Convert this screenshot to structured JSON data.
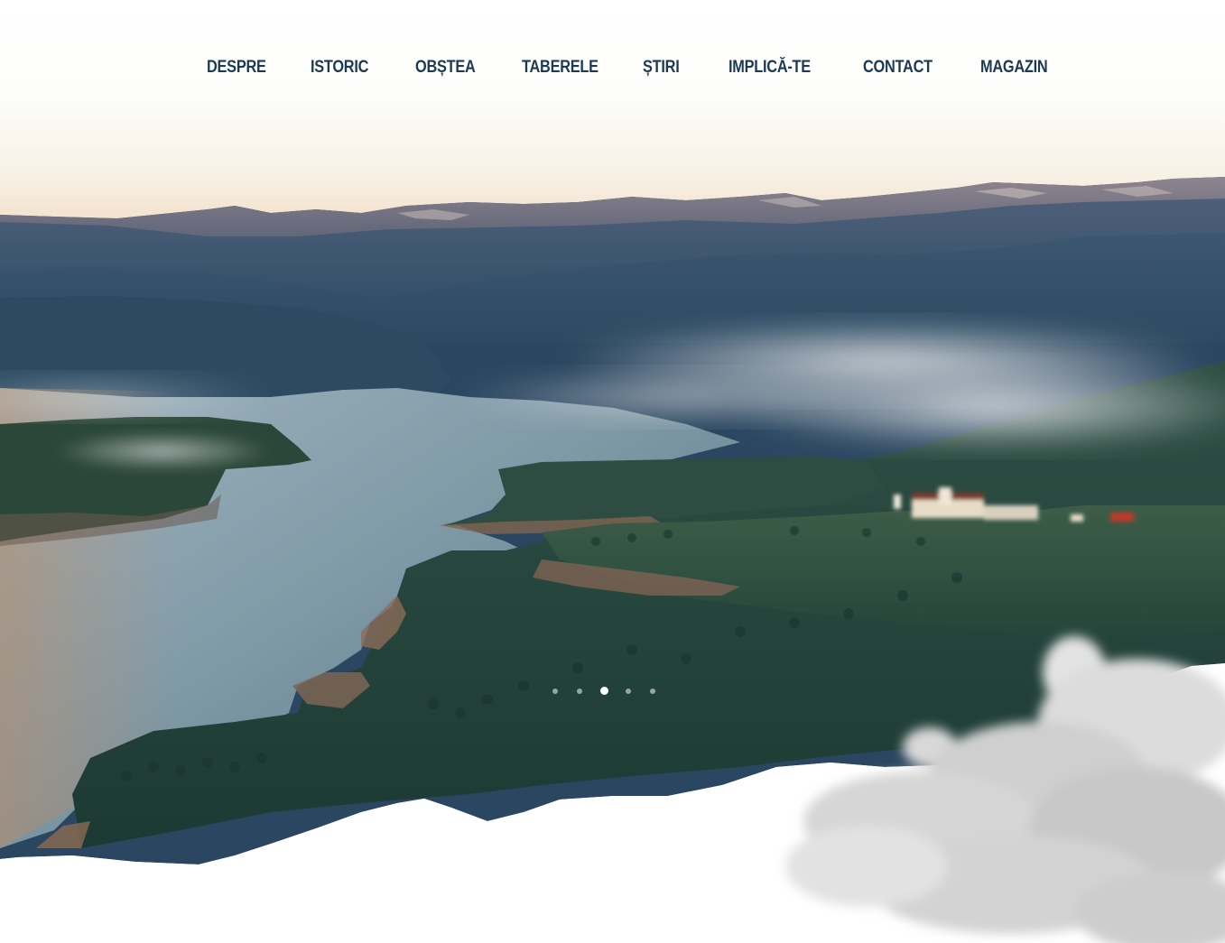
{
  "nav": {
    "items": [
      {
        "label": "DESPRE"
      },
      {
        "label": "ISTORIC"
      },
      {
        "label": "OBȘTEA"
      },
      {
        "label": "TABERELE"
      },
      {
        "label": "ȘTIRI"
      },
      {
        "label": "IMPLICĂ-TE"
      },
      {
        "label": "CONTACT"
      },
      {
        "label": "MAGAZIN"
      }
    ],
    "color": "#1d3a52"
  },
  "slider": {
    "slide_count": 5,
    "active_index": 2
  },
  "colors": {
    "nav_text": "#1d3a52",
    "page_background": "#ffffff",
    "active_dot": "#ffffff"
  }
}
